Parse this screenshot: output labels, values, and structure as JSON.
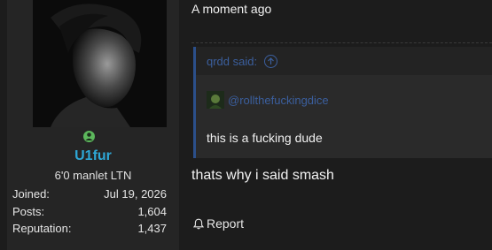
{
  "user": {
    "name": "U1fur",
    "title": "6'0 manlet LTN",
    "stats": [
      {
        "label": "Joined:",
        "value": "Jul 19, 2026"
      },
      {
        "label": "Posts:",
        "value": "1,604"
      },
      {
        "label": "Reputation:",
        "value": "1,437"
      }
    ]
  },
  "post": {
    "timestamp": "A moment ago",
    "quote": {
      "author": "qrdd said:",
      "mention": "@rollthefuckingdice",
      "body": "this is a fucking dude"
    },
    "message": "thats why i said smash",
    "report_label": "Report"
  },
  "colors": {
    "username": "#2ea7d6",
    "online": "#5cb85c",
    "quote_accent": "#2b4f8a",
    "link": "#3b5f9e"
  },
  "icons": {
    "online": "user-online-icon",
    "jump": "arrow-up-circle-icon",
    "report": "bell-icon"
  }
}
